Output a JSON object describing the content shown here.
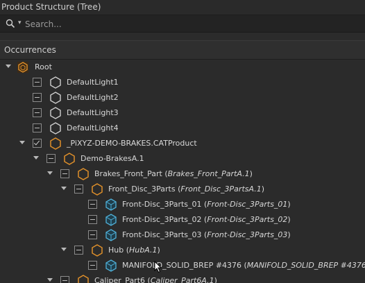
{
  "panel": {
    "title": "Product Structure (Tree)"
  },
  "search": {
    "placeholder": "Search..."
  },
  "tree_header": {
    "label": "Occurrences"
  },
  "tree": {
    "rows": [
      {
        "name": "Root",
        "ref": ""
      },
      {
        "name": "DefaultLight1",
        "ref": ""
      },
      {
        "name": "DefaultLight2",
        "ref": ""
      },
      {
        "name": "DefaultLight3",
        "ref": ""
      },
      {
        "name": "DefaultLight4",
        "ref": ""
      },
      {
        "name": "_PiXYZ-DEMO-BRAKES.CATProduct",
        "ref": ""
      },
      {
        "name": "Demo-BrakesA.1",
        "ref": ""
      },
      {
        "name": "Brakes_Front_Part",
        "ref": "Brakes_Front_PartA.1"
      },
      {
        "name": "Front_Disc_3Parts",
        "ref": "Front_Disc_3PartsA.1"
      },
      {
        "name": "Front-Disc_3Parts_01",
        "ref": "Front-Disc_3Parts_01"
      },
      {
        "name": "Front-Disc_3Parts_02",
        "ref": "Front-Disc_3Parts_02"
      },
      {
        "name": "Front-Disc_3Parts_03",
        "ref": "Front-Disc_3Parts_03"
      },
      {
        "name": "Hub",
        "ref": "HubA.1"
      },
      {
        "name": "MANIFOLD_SOLID_BREP #4376",
        "ref": "MANIFOLD_SOLID_BREP #4376"
      },
      {
        "name": "Caliper_Part6",
        "ref": "Caliper_Part6A.1"
      }
    ]
  },
  "colors": {
    "assembly_icon": "#e0902a",
    "light_icon": "#d0d0d0",
    "part_icon": "#4fb0d8",
    "background": "#2b2b2b"
  },
  "icons": [
    "search-icon",
    "assembly-icon",
    "light-icon",
    "part-icon",
    "mouse-cursor-icon"
  ]
}
